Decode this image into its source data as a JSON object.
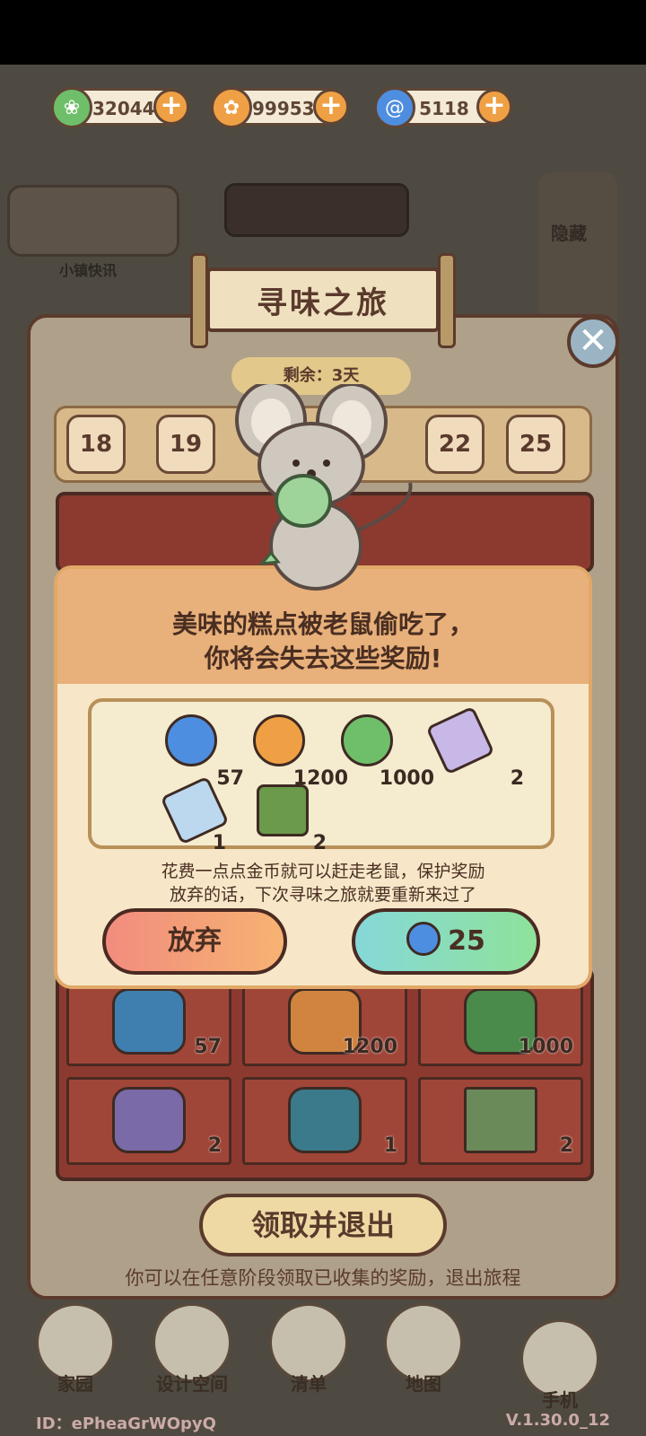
{
  "currencies": [
    {
      "name": "leaf",
      "value": "32044",
      "color": "#6fbf6a",
      "icon": "leaf-coin-icon"
    },
    {
      "name": "orange",
      "value": "99953",
      "color": "#f0a044",
      "icon": "orange-coin-icon"
    },
    {
      "name": "gem",
      "value": "5118",
      "color": "#4e8ee0",
      "icon": "swirl-gem-icon"
    }
  ],
  "banner_title": "寻味之旅",
  "remaining": "剩余：3天",
  "days": [
    "18",
    "19",
    "22",
    "25"
  ],
  "modal": {
    "line1": "美味的糕点被老鼠偷吃了，",
    "line2": "你将会失去这些奖励!",
    "rewards": [
      {
        "icon": "swirl-gem-icon",
        "count": "57",
        "color": "#4e8ee0"
      },
      {
        "icon": "orange-coin-icon",
        "count": "1200",
        "color": "#f0a044"
      },
      {
        "icon": "leaf-coin-icon",
        "count": "1000",
        "color": "#6fbf6a"
      },
      {
        "icon": "purple-ticket-icon",
        "count": "2",
        "color": "#c8b8e8"
      },
      {
        "icon": "blue-ticket-icon",
        "count": "1",
        "color": "#bcd8ee"
      },
      {
        "icon": "green-bottle-icon",
        "count": "2",
        "color": "#6a9a4a"
      }
    ],
    "note1": "花费一点点金币就可以赶走老鼠，保护奖励",
    "note2": "放弃的话，下次寻味之旅就要重新来过了",
    "give_up": "放弃",
    "pay_cost": "25"
  },
  "grid": [
    {
      "count": "57",
      "color": "#3f7fb0"
    },
    {
      "count": "1200",
      "color": "#d08440"
    },
    {
      "count": "1000",
      "color": "#4a8a4a"
    },
    {
      "count": "2",
      "color": "#7a6aa8"
    },
    {
      "count": "1",
      "color": "#3a7a8a"
    },
    {
      "count": "2",
      "color": "#6a8a5a"
    }
  ],
  "claim_button": "领取并退出",
  "claim_tip": "你可以在任意阶段领取已收集的奖励，退出旅程",
  "nav": [
    "家园",
    "设计空间",
    "清单",
    "地图",
    "手机"
  ],
  "bg_labels": {
    "news": "小镇快讯",
    "hide": "隐藏"
  },
  "user_id": "ID：ePheaGrWOpyQ",
  "version": "V.1.30.0_12"
}
